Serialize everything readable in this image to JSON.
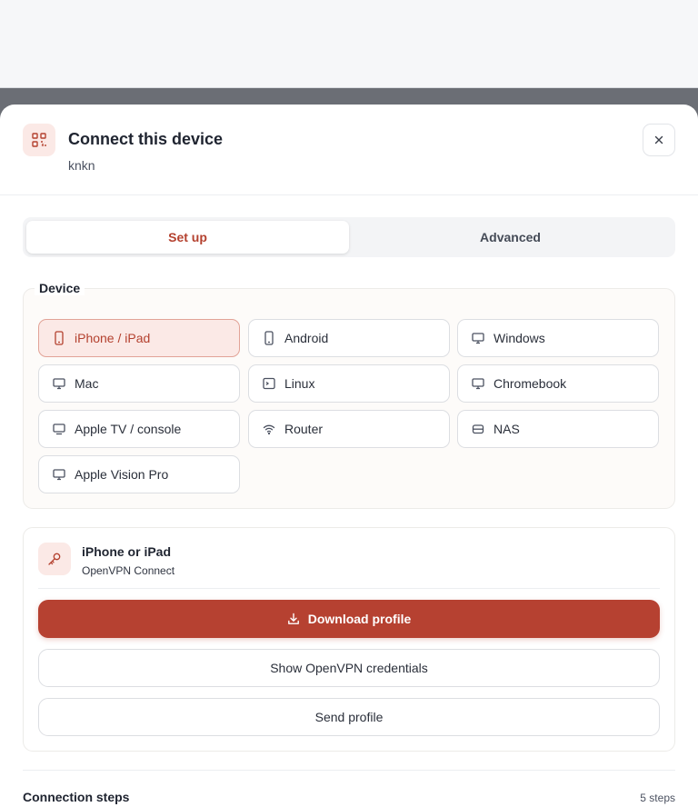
{
  "header": {
    "title": "Connect this device",
    "subtitle": "knkn"
  },
  "tabs": [
    {
      "label": "Set up",
      "active": true
    },
    {
      "label": "Advanced",
      "active": false
    }
  ],
  "device_section": {
    "legend": "Device",
    "options": [
      {
        "label": "iPhone / iPad",
        "icon": "phone-icon",
        "selected": true
      },
      {
        "label": "Android",
        "icon": "phone-icon",
        "selected": false
      },
      {
        "label": "Windows",
        "icon": "monitor-icon",
        "selected": false
      },
      {
        "label": "Mac",
        "icon": "monitor-icon",
        "selected": false
      },
      {
        "label": "Linux",
        "icon": "terminal-icon",
        "selected": false
      },
      {
        "label": "Chromebook",
        "icon": "monitor-icon",
        "selected": false
      },
      {
        "label": "Apple TV / console",
        "icon": "tv-icon",
        "selected": false
      },
      {
        "label": "Router",
        "icon": "wifi-icon",
        "selected": false
      },
      {
        "label": "NAS",
        "icon": "storage-icon",
        "selected": false
      },
      {
        "label": "Apple Vision Pro",
        "icon": "monitor-icon",
        "selected": false
      }
    ]
  },
  "profile_card": {
    "title": "iPhone or iPad",
    "subtitle": "OpenVPN Connect",
    "download_label": "Download profile",
    "credentials_label": "Show OpenVPN credentials",
    "send_label": "Send profile"
  },
  "steps": {
    "title": "Connection steps",
    "count": "5 steps"
  },
  "colors": {
    "accent": "#b64131",
    "accent_bg": "#fbe9e6",
    "overlay": "#6b6e75"
  }
}
